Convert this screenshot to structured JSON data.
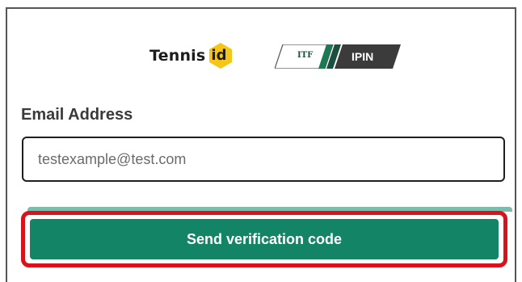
{
  "brand": {
    "tennisid_wordmark": "Tennis",
    "tennisid_badge": "id",
    "itf_mark": "ITF",
    "ipin_label": "IPIN",
    "tennisid_accent_color": "#f5c518",
    "ipin_color": "#3b3b3b",
    "itf_stripe_color": "#1b7a55"
  },
  "form": {
    "email_label": "Email Address",
    "email_value": "testexample@test.com",
    "send_button_label": "Send verification code",
    "button_color": "#138466",
    "highlight_color": "#d6141b"
  }
}
